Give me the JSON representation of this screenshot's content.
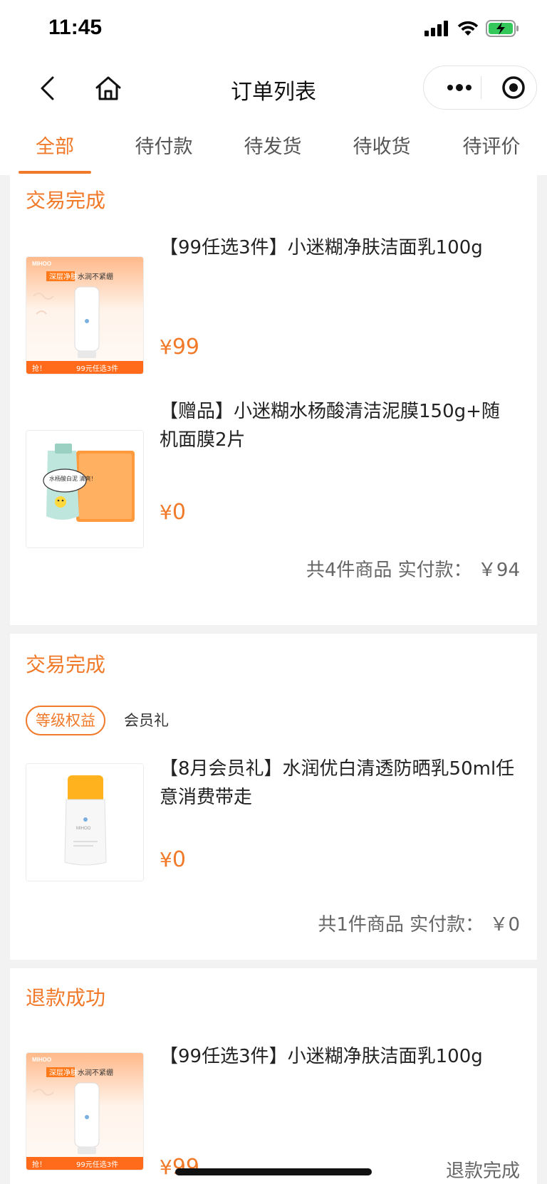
{
  "status_bar": {
    "time": "11:45"
  },
  "navbar": {
    "title": "订单列表"
  },
  "tabs": [
    {
      "label": "全部",
      "active": true
    },
    {
      "label": "待付款",
      "active": false
    },
    {
      "label": "待发货",
      "active": false
    },
    {
      "label": "待收货",
      "active": false
    },
    {
      "label": "待评价",
      "active": false
    }
  ],
  "orders": [
    {
      "status": "交易完成",
      "items": [
        {
          "title": "【99任选3件】小迷糊净肤洁面乳100g",
          "price": "99",
          "image": {
            "brand": "MIHOO",
            "headline_highlight": "深层净肤",
            "headline": "水润不紧绷",
            "footer_left": "抢！",
            "footer_right": "99元任选3件"
          }
        },
        {
          "title": "【赠品】小迷糊水杨酸清洁泥膜150g+随机面膜2片",
          "price": "0",
          "image": {
            "bubble_text": "水杨酸白泥 清爽！"
          }
        }
      ],
      "summary_count": "共4件商品",
      "summary_paid_label": "实付款：",
      "summary_paid_value": "￥94"
    },
    {
      "status": "交易完成",
      "badge": "等级权益",
      "badge_sub": "会员礼",
      "items": [
        {
          "title": "【8月会员礼】水润优白清透防晒乳50ml任意消费带走",
          "price": "0",
          "image": {
            "brand": "MIHOO"
          }
        }
      ],
      "summary_count": "共1件商品",
      "summary_paid_label": "实付款：",
      "summary_paid_value": "￥0"
    },
    {
      "status": "退款成功",
      "items": [
        {
          "title": "【99任选3件】小迷糊净肤洁面乳100g",
          "price": "99",
          "image": {
            "brand": "MIHOO",
            "headline_highlight": "深层净肤",
            "headline": "水润不紧绷",
            "footer_left": "抢！",
            "footer_right": "99元任选3件"
          }
        }
      ],
      "refund_status": "退款完成"
    }
  ],
  "currency_symbol": "¥",
  "colors": {
    "accent": "#f07a2a",
    "background": "#f2f2f2"
  }
}
